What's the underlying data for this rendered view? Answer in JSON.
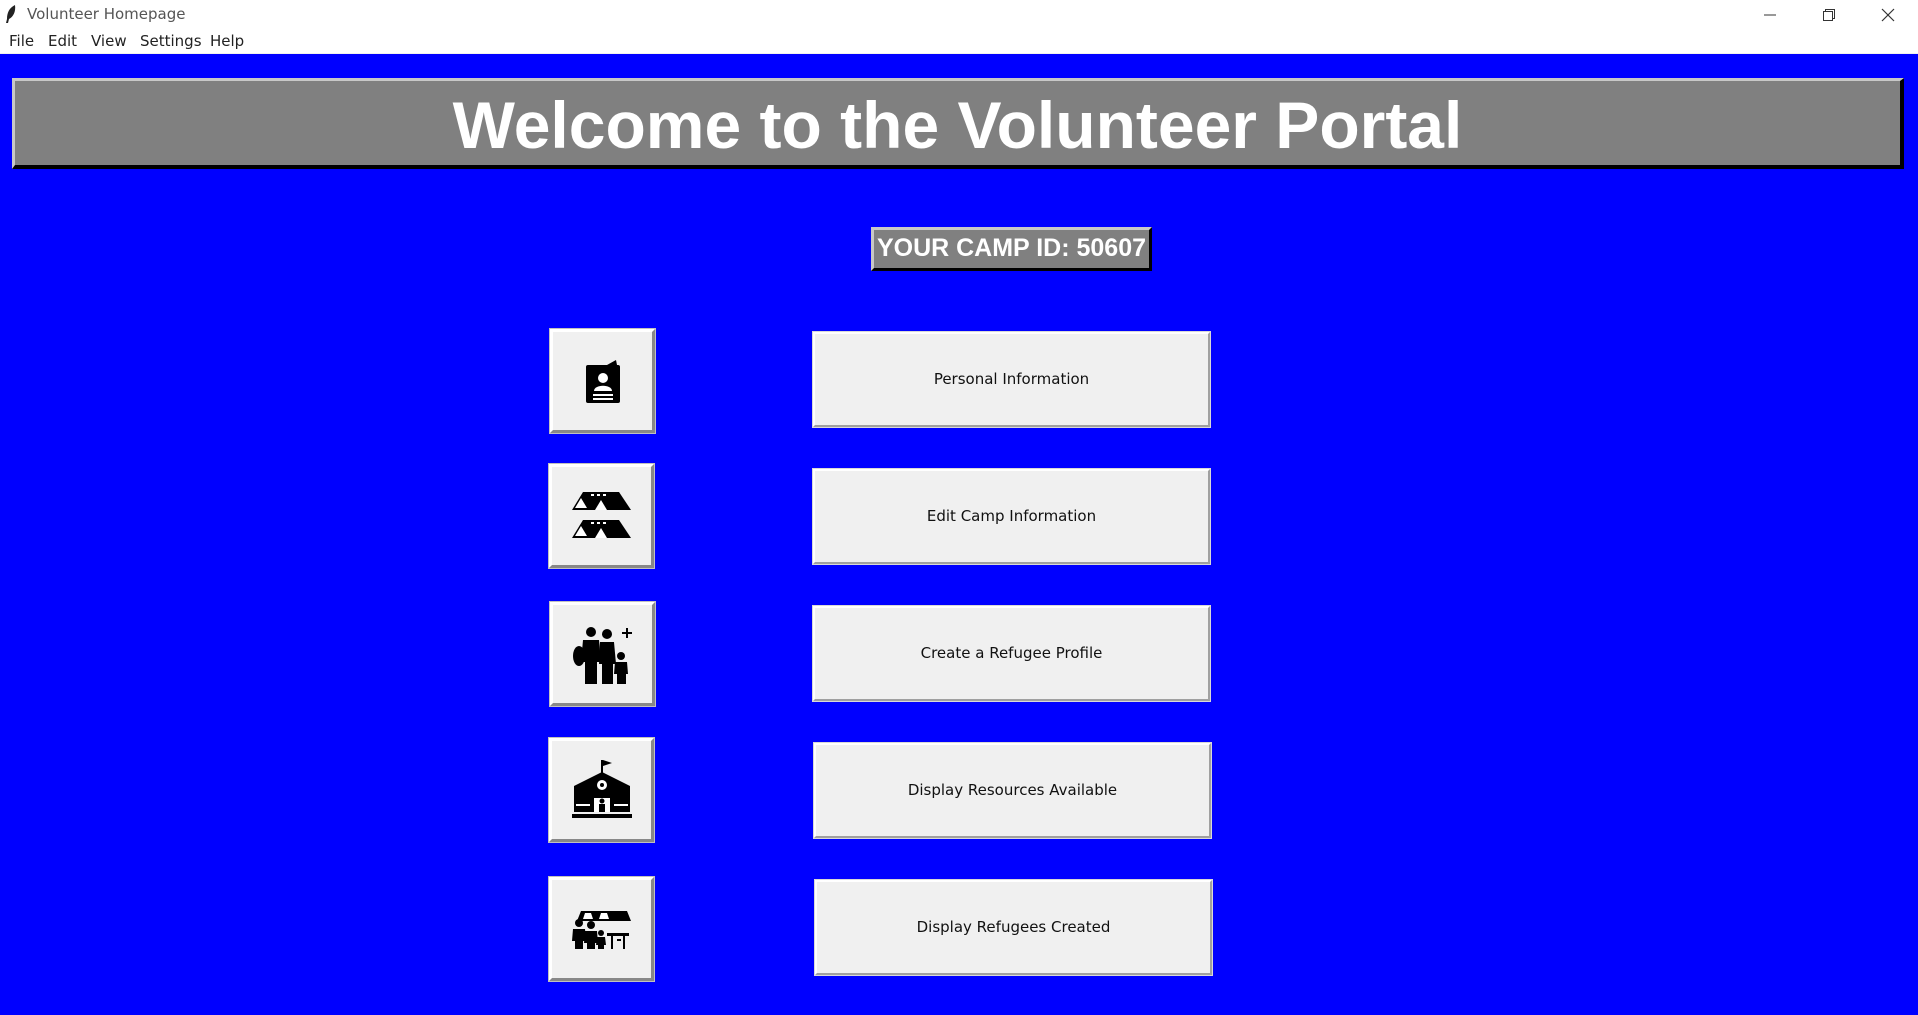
{
  "window": {
    "title": "Volunteer Homepage"
  },
  "menu": {
    "items": [
      "File",
      "Edit",
      "View",
      "Settings",
      "Help"
    ]
  },
  "banner": {
    "title": "Welcome to the Volunteer Portal"
  },
  "camp_id_label": "YOUR CAMP ID: 50607",
  "actions": [
    {
      "label": "Personal Information",
      "icon": "id-badge-icon"
    },
    {
      "label": "Edit Camp Information",
      "icon": "tents-icon"
    },
    {
      "label": "Create a Refugee Profile",
      "icon": "family-add-icon"
    },
    {
      "label": "Display Resources Available",
      "icon": "shelter-building-icon"
    },
    {
      "label": "Display Refugees Created",
      "icon": "refugee-group-icon"
    }
  ],
  "colors": {
    "background": "#0000ff",
    "banner": "#808080",
    "button": "#f0f0f0",
    "text_on_dark": "#ffffff"
  }
}
